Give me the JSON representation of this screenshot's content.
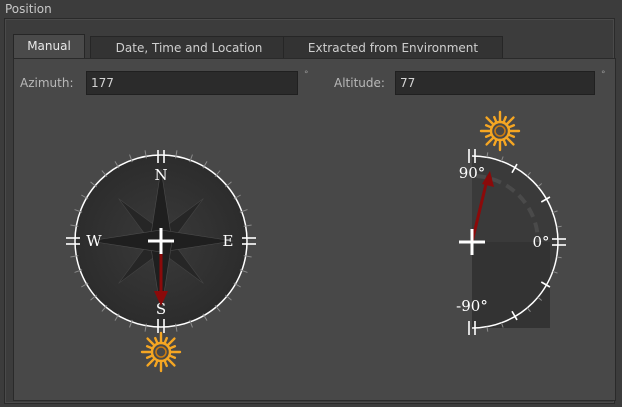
{
  "group": {
    "title": "Position"
  },
  "tabs": [
    {
      "label": "Manual",
      "active": true
    },
    {
      "label": "Date, Time and Location",
      "active": false
    },
    {
      "label": "Extracted from Environment",
      "active": false
    }
  ],
  "azimuth": {
    "label": "Azimuth:",
    "value": "177",
    "unit": "°"
  },
  "altitude": {
    "label": "Altitude:",
    "value": "77",
    "unit": "°"
  },
  "compass": {
    "north": "N",
    "south": "S",
    "east": "E",
    "west": "W"
  },
  "altitude_dial": {
    "top": "90°",
    "mid": "0°",
    "bottom": "-90°"
  },
  "icons": {
    "sun": "sun-icon",
    "center": "crosshair-icon",
    "needle": "needle-icon"
  },
  "colors": {
    "needle": "#8b0a0a",
    "sun": "#f5a623",
    "dial": "#ffffff"
  }
}
